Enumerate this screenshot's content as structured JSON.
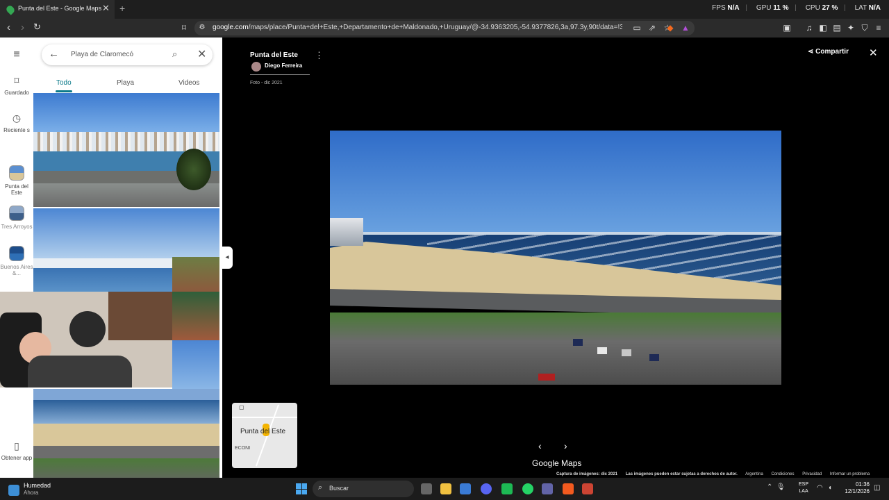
{
  "browser": {
    "tab_title": "Punta del Este - Google Maps",
    "new_tab": "+",
    "url_host": "google.com",
    "url_path": "/maps/place/Punta+del+Este,+Departamento+de+Maldonado,+Uruguay/@-34.9363205,-54.9377826,3a,97.3y,90t/data=!3m8!1e2!...",
    "perf": {
      "fps_label": "FPS",
      "fps_value": "N/A",
      "gpu_label": "GPU",
      "gpu_value": "11 %",
      "cpu_label": "CPU",
      "cpu_value": "27 %",
      "lat_label": "LAT",
      "lat_value": "N/A"
    }
  },
  "rail": {
    "saved": "Guardado",
    "recent": "Reciente s",
    "place1": "Punta del Este",
    "place2": "Tres Arroyos",
    "place3": "Buenos Aires &...",
    "get_app": "Obtener app"
  },
  "panel": {
    "search_text": "Playa de Claromecó",
    "tabs": [
      "Todo",
      "Playa",
      "Videos"
    ]
  },
  "viewer": {
    "title": "Punta del Este",
    "author": "Diego Ferreira",
    "date": "Foto - dic 2021",
    "share": "Compartir",
    "minimap_label": "Punta del Este",
    "minimap_sub": "ECONI",
    "brand": "Google Maps",
    "footer": [
      "Captura de imágenes: dic 2021",
      "Las imágenes pueden estar sujetas a derechos de autor.",
      "Argentina",
      "Condiciones",
      "Privacidad",
      "Informar un problema"
    ]
  },
  "taskbar": {
    "weather_title": "Humedad",
    "weather_sub": "Ahora",
    "search": "Buscar",
    "lang1": "ESP",
    "lang2": "LAA",
    "time": "01:36",
    "date": "12/1/2026"
  },
  "colors": {
    "accent": "#0b7a8a",
    "sky": "#3f77c9",
    "sea": "#2a5a8c",
    "sand": "#d8c69a"
  }
}
